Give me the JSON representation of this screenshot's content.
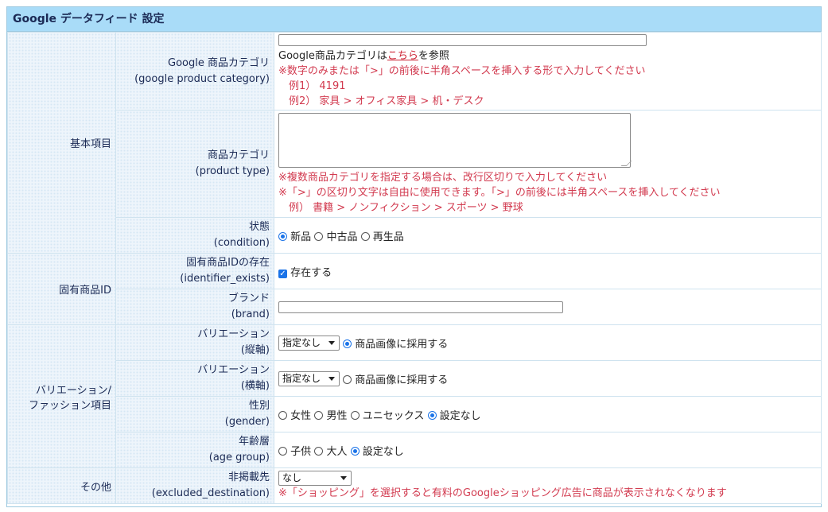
{
  "title": "Google データフィード 設定",
  "groups": {
    "basic": "基本項目",
    "identifier": "固有商品ID",
    "variation": "バリエーション/",
    "variation2": "ファッション項目",
    "other": "その他"
  },
  "fields": {
    "gpc": {
      "label1": "Google 商品カテゴリ",
      "label2": "(google product category)",
      "value": "",
      "help_prefix": "Google商品カテゴリは",
      "help_link": "こちら",
      "help_suffix": "を参照",
      "note1": "※数字のみまたは「>」の前後に半角スペースを挿入する形で入力してください",
      "note2": "例1） 4191",
      "note3": "例2） 家具 > オフィス家具 > 机・デスク"
    },
    "ptype": {
      "label1": "商品カテゴリ",
      "label2": "(product type)",
      "value": "",
      "note1": "※複数商品カテゴリを指定する場合は、改行区切りで入力してください",
      "note2": "※「>」の区切り文字は自由に使用できます。「>」の前後には半角スペースを挿入してください",
      "note3": "例） 書籍 > ノンフィクション > スポーツ > 野球"
    },
    "condition": {
      "label1": "状態",
      "label2": "(condition)",
      "options": [
        "新品",
        "中古品",
        "再生品"
      ],
      "selected": "新品"
    },
    "identifier": {
      "label1": "固有商品IDの存在",
      "label2": "(identifier_exists)",
      "checkbox_label": "存在する",
      "checked": true
    },
    "brand": {
      "label1": "ブランド",
      "label2": "(brand)",
      "value": ""
    },
    "var_v": {
      "label1": "バリエーション",
      "label2": "(縦軸)",
      "select": "指定なし",
      "radio_label": "商品画像に採用する",
      "radio_on": true
    },
    "var_h": {
      "label1": "バリエーション",
      "label2": "(横軸)",
      "select": "指定なし",
      "radio_label": "商品画像に採用する",
      "radio_on": false
    },
    "gender": {
      "label1": "性別",
      "label2": "(gender)",
      "options": [
        "女性",
        "男性",
        "ユニセックス",
        "設定なし"
      ],
      "selected": "設定なし"
    },
    "age": {
      "label1": "年齢層",
      "label2": "(age group)",
      "options": [
        "子供",
        "大人",
        "設定なし"
      ],
      "selected": "設定なし"
    },
    "excluded": {
      "label1": "非掲載先",
      "label2": "(excluded_destination)",
      "select": "なし",
      "note": "※「ショッピング」を選択すると有料のGoogleショッピング広告に商品が表示されなくなります"
    }
  },
  "colors": {
    "header": "#a9dcf8",
    "accent": "#1a73e8",
    "note": "#d23a4f",
    "label": "#1b2a55"
  }
}
